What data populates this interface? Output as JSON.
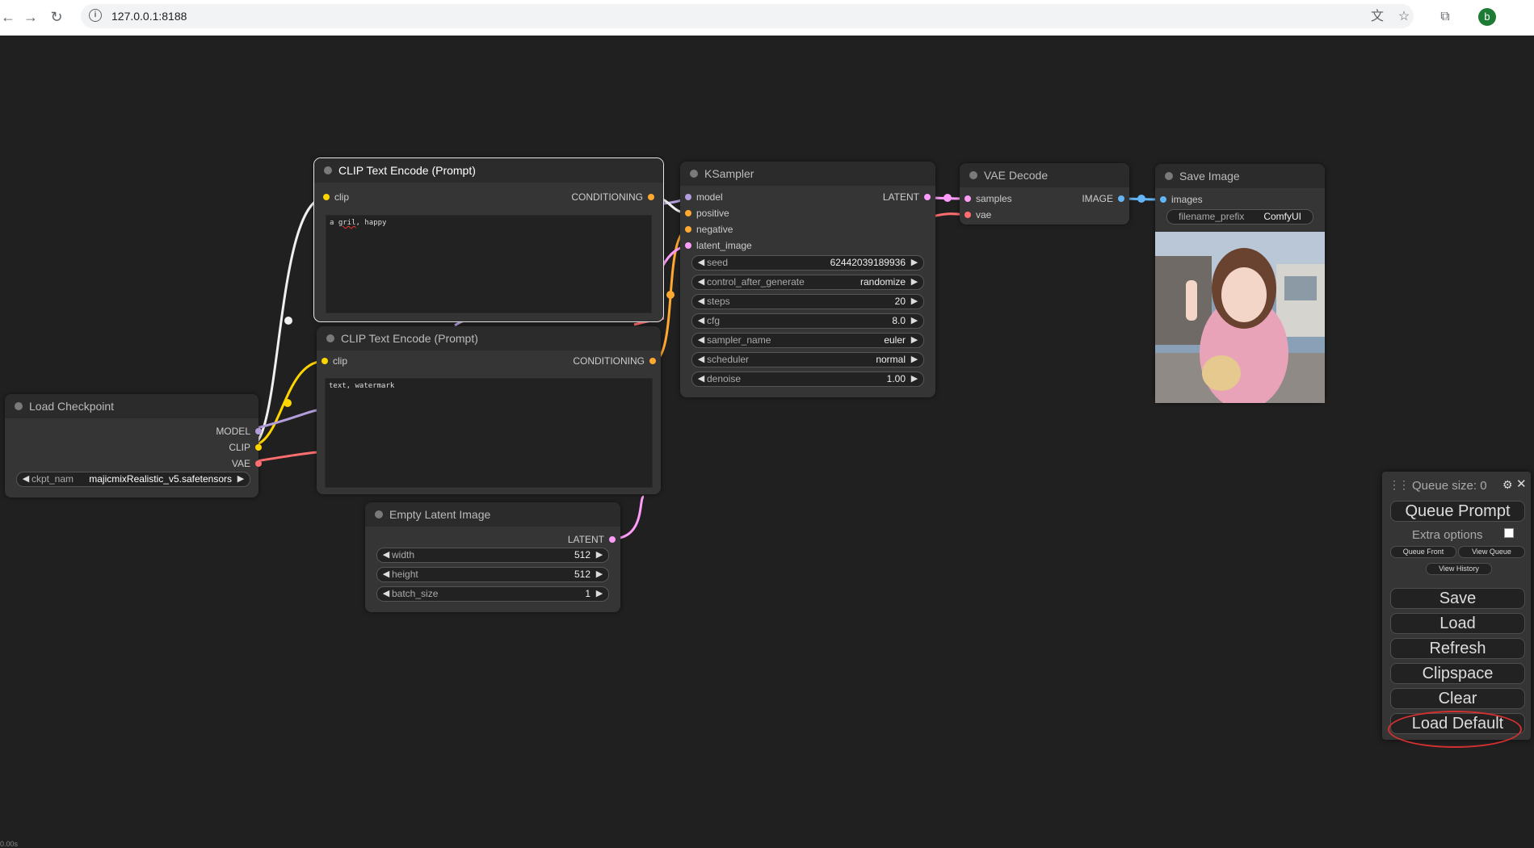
{
  "browser": {
    "url": "127.0.0.1:8188",
    "avatar_letter": "b",
    "icons": [
      "back-icon",
      "forward-icon",
      "reload-icon",
      "info-icon",
      "translate-icon",
      "star-icon",
      "extensions-icon"
    ]
  },
  "nodes": {
    "clip_positive": {
      "title": "CLIP Text Encode (Prompt)",
      "input": "clip",
      "output": "CONDITIONING",
      "text_before": "a ",
      "text_misspelled": "gril",
      "text_after": ", happy"
    },
    "clip_negative": {
      "title": "CLIP Text Encode (Prompt)",
      "input": "clip",
      "output": "CONDITIONING",
      "text": "text, watermark"
    },
    "ksampler": {
      "title": "KSampler",
      "inputs": [
        "model",
        "positive",
        "negative",
        "latent_image"
      ],
      "output": "LATENT",
      "widgets": [
        {
          "label": "seed",
          "value": "62442039189936"
        },
        {
          "label": "control_after_generate",
          "value": "randomize"
        },
        {
          "label": "steps",
          "value": "20"
        },
        {
          "label": "cfg",
          "value": "8.0"
        },
        {
          "label": "sampler_name",
          "value": "euler"
        },
        {
          "label": "scheduler",
          "value": "normal"
        },
        {
          "label": "denoise",
          "value": "1.00"
        }
      ]
    },
    "vae_decode": {
      "title": "VAE Decode",
      "inputs": [
        "samples",
        "vae"
      ],
      "output": "IMAGE"
    },
    "save_image": {
      "title": "Save Image",
      "input": "images",
      "widget_label": "filename_prefix",
      "widget_value": "ComfyUI"
    },
    "load_checkpoint": {
      "title": "Load Checkpoint",
      "outputs": [
        "MODEL",
        "CLIP",
        "VAE"
      ],
      "widget_label": "ckpt_nam",
      "widget_value": "majicmixRealistic_v5.safetensors"
    },
    "empty_latent": {
      "title": "Empty Latent Image",
      "output": "LATENT",
      "widgets": [
        {
          "label": "width",
          "value": "512"
        },
        {
          "label": "height",
          "value": "512"
        },
        {
          "label": "batch_size",
          "value": "1"
        }
      ]
    }
  },
  "panel": {
    "queue_size": "Queue size: 0",
    "queue_prompt": "Queue Prompt",
    "extra_options": "Extra options",
    "queue_front": "Queue Front",
    "view_queue": "View Queue",
    "view_history": "View History",
    "save": "Save",
    "load": "Load",
    "refresh": "Refresh",
    "clipspace": "Clipspace",
    "clear": "Clear",
    "load_default": "Load Default"
  },
  "colors": {
    "canvas_bg": "#202020",
    "node_bg": "#353535",
    "clip": "#ffd500",
    "model": "#b39ddb",
    "conditioning": "#ffa931",
    "latent": "#ff9cf9",
    "vae": "#ff6e6e",
    "image": "#64b5f6",
    "annotation": "#d43030"
  },
  "timer": "0.00s"
}
